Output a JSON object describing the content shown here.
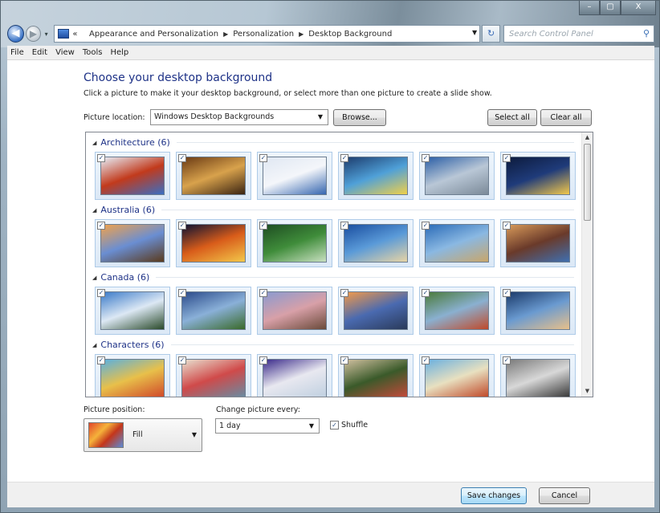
{
  "window": {
    "caption_buttons": [
      "–",
      "▢",
      "X"
    ]
  },
  "nav": {
    "back_glyph": "◀",
    "fwd_glyph": "▶",
    "history_drop": "▾",
    "address_prefix": "«",
    "breadcrumb": [
      "Appearance and Personalization",
      "Personalization",
      "Desktop Background"
    ],
    "refresh_glyph": "↻",
    "search_placeholder": "Search Control Panel"
  },
  "menu": [
    "File",
    "Edit",
    "View",
    "Tools",
    "Help"
  ],
  "main": {
    "title": "Choose your desktop background",
    "subtitle": "Click a picture to make it your desktop background, or select more than one picture to create a slide show.",
    "location_label": "Picture location:",
    "location_value": "Windows Desktop Backgrounds",
    "browse_label": "Browse...",
    "select_all_label": "Select all",
    "clear_all_label": "Clear all"
  },
  "gallery": {
    "groups": [
      {
        "name": "Architecture (6)",
        "images": [
          {
            "colors": [
              "#e6eef8",
              "#c23a1c",
              "#3a6ec2"
            ],
            "checked": true
          },
          {
            "colors": [
              "#6a3a14",
              "#d8a24c",
              "#3a2412"
            ],
            "checked": true
          },
          {
            "colors": [
              "#dfe7f2",
              "#f4f6fa",
              "#3566b0"
            ],
            "checked": true
          },
          {
            "colors": [
              "#1d3d6e",
              "#4fa0d8",
              "#f0d04a"
            ],
            "checked": true
          },
          {
            "colors": [
              "#2b5fa6",
              "#b9c7d6",
              "#7b8a99"
            ],
            "checked": true
          },
          {
            "colors": [
              "#0d1b3d",
              "#1f3b7a",
              "#f3c84a"
            ],
            "checked": true
          }
        ]
      },
      {
        "name": "Australia (6)",
        "images": [
          {
            "colors": [
              "#f0a24c",
              "#6a8ed2",
              "#5a3a1c"
            ],
            "checked": true
          },
          {
            "colors": [
              "#0d1233",
              "#d85c1a",
              "#f3c84a"
            ],
            "checked": true
          },
          {
            "colors": [
              "#1e4d22",
              "#3f8c3a",
              "#c8e0c0"
            ],
            "checked": true
          },
          {
            "colors": [
              "#1a4ea0",
              "#5a9ad8",
              "#e8d4a4"
            ],
            "checked": true
          },
          {
            "colors": [
              "#2c6cb8",
              "#8ab8e2",
              "#c9a66a"
            ],
            "checked": true
          },
          {
            "colors": [
              "#d89a5a",
              "#6a3a2a",
              "#3f6fb0"
            ],
            "checked": true
          }
        ]
      },
      {
        "name": "Canada (6)",
        "images": [
          {
            "colors": [
              "#3a7ac8",
              "#dce8f4",
              "#2a4a2a"
            ],
            "checked": true
          },
          {
            "colors": [
              "#2a4a8a",
              "#8ab0d8",
              "#3a6a2a"
            ],
            "checked": true
          },
          {
            "colors": [
              "#8a9ad0",
              "#d8a0a8",
              "#6a4a3a"
            ],
            "checked": true
          },
          {
            "colors": [
              "#f29a4a",
              "#4a6ab0",
              "#2a3a5a"
            ],
            "checked": true
          },
          {
            "colors": [
              "#4a7a3a",
              "#8ab0d0",
              "#c04a2a"
            ],
            "checked": true
          },
          {
            "colors": [
              "#1a3a6a",
              "#6a9ad0",
              "#e8c08a"
            ],
            "checked": true
          }
        ]
      },
      {
        "name": "Characters (6)",
        "images": [
          {
            "colors": [
              "#5ab0e0",
              "#e8c04a",
              "#d04a2a"
            ],
            "checked": true
          },
          {
            "colors": [
              "#e8e0d0",
              "#d04a4a",
              "#6a8aa0"
            ],
            "checked": true
          },
          {
            "colors": [
              "#3a2a8a",
              "#e8e8f0",
              "#c0d0e0"
            ],
            "checked": true
          },
          {
            "colors": [
              "#d0c0a0",
              "#3a5a2a",
              "#c04a3a"
            ],
            "checked": true
          },
          {
            "colors": [
              "#6ab0e0",
              "#e8e0c0",
              "#c04a2a"
            ],
            "checked": true
          },
          {
            "colors": [
              "#7a7a7a",
              "#d8d8d8",
              "#3a3a3a"
            ],
            "checked": true
          }
        ]
      }
    ]
  },
  "options": {
    "position_label": "Picture position:",
    "position_value": "Fill",
    "interval_label": "Change picture every:",
    "interval_value": "1 day",
    "shuffle_label": "Shuffle",
    "shuffle_checked": true
  },
  "footer": {
    "save_label": "Save changes",
    "cancel_label": "Cancel"
  }
}
